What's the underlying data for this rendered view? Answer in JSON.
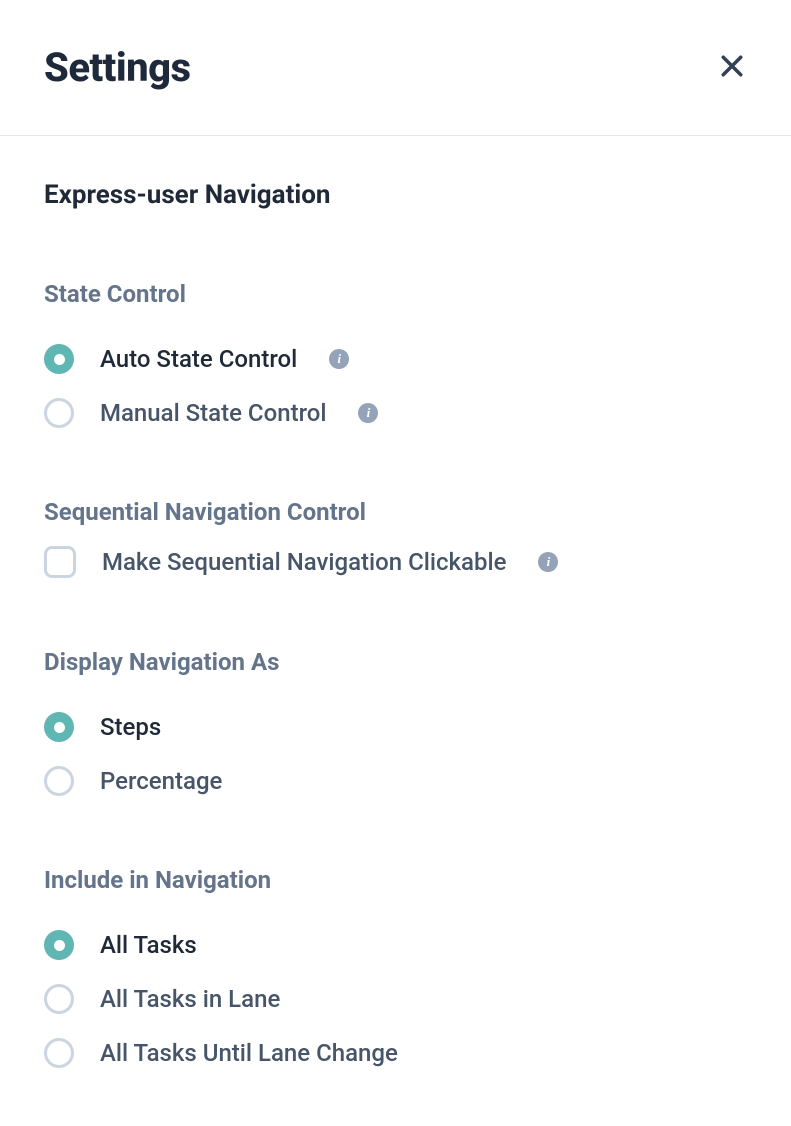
{
  "header": {
    "title": "Settings"
  },
  "section": {
    "title": "Express-user Navigation"
  },
  "stateControl": {
    "title": "State Control",
    "options": [
      {
        "label": "Auto State Control",
        "selected": true,
        "info": true
      },
      {
        "label": "Manual State Control",
        "selected": false,
        "info": true
      }
    ]
  },
  "seqNav": {
    "title": "Sequential Navigation Control",
    "checkbox": {
      "label": "Make Sequential Navigation Clickable",
      "checked": false,
      "info": true
    }
  },
  "displayAs": {
    "title": "Display Navigation As",
    "options": [
      {
        "label": "Steps",
        "selected": true
      },
      {
        "label": "Percentage",
        "selected": false
      }
    ]
  },
  "includeIn": {
    "title": "Include in Navigation",
    "options": [
      {
        "label": "All Tasks",
        "selected": true
      },
      {
        "label": "All Tasks in Lane",
        "selected": false
      },
      {
        "label": "All Tasks Until Lane Change",
        "selected": false
      }
    ]
  }
}
